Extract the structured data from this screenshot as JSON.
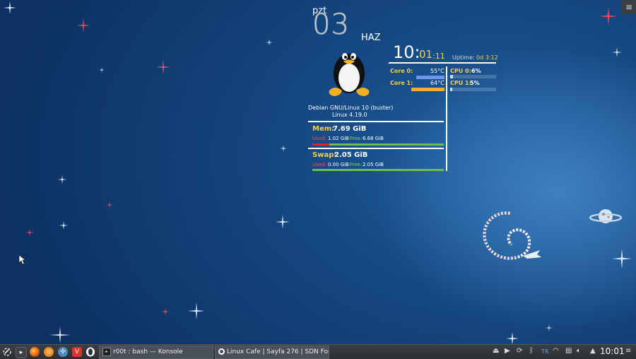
{
  "conky": {
    "user": "pzt",
    "day": "03",
    "month": "HAZ",
    "time_hour": "10:",
    "time_min": "01",
    "time_sec": ":11",
    "uptime_label": "Uptime:",
    "uptime_value": "0d 3:12",
    "os_name": "Debian GNU/Linux 10 (buster)",
    "kernel": "Linux 4.19.0",
    "temps": [
      {
        "label": "Core 0:",
        "value": "55°C",
        "level": 0.55,
        "color": "#6f95e8"
      },
      {
        "label": "Core 1:",
        "value": "64°C",
        "level": 0.64,
        "color": "#f4a93a"
      }
    ],
    "cpus": [
      {
        "label": "CPU 0:",
        "value": "6%",
        "level": 0.06
      },
      {
        "label": "CPU 1:",
        "value": "5%",
        "level": 0.05
      }
    ],
    "mem": {
      "label": "Mem:",
      "total": "7.69 GiB",
      "used_label": "Used:",
      "used": "1.02 GiB",
      "free_label": "Free:",
      "free": "6.68 GiB",
      "used_fraction": 0.13
    },
    "swap": {
      "label": "Swap:",
      "total": "2.05 GiB",
      "used_label": "Used:",
      "used": "0.00 GiB",
      "free_label": "Free:",
      "free": "2.05 GiB",
      "used_fraction": 0.0
    }
  },
  "taskbar": {
    "tasks": [
      {
        "label": "r00t : bash — Konsole"
      },
      {
        "label": "Linux Cafe | Sayfa 276 | SDN For..."
      }
    ],
    "keyboard_layout": "TR",
    "clock": "10:01"
  },
  "colors": {
    "accent_yellow": "#f6d04d",
    "bar_green": "#6cc04a",
    "bar_red": "#e0242d"
  }
}
